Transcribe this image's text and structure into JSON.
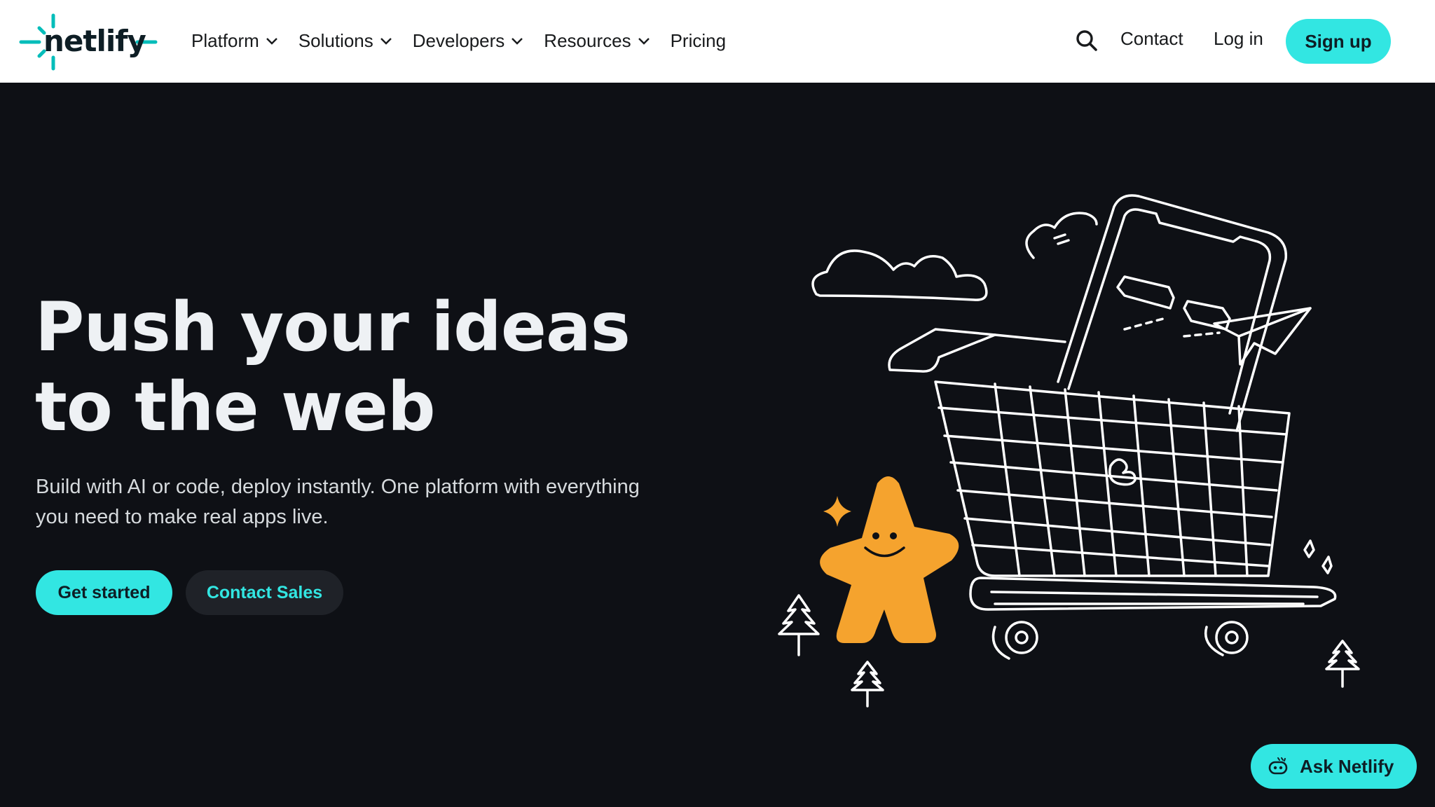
{
  "header": {
    "logo_text": "netlify",
    "nav": [
      {
        "label": "Platform",
        "has_dropdown": true
      },
      {
        "label": "Solutions",
        "has_dropdown": true
      },
      {
        "label": "Developers",
        "has_dropdown": true
      },
      {
        "label": "Resources",
        "has_dropdown": true
      },
      {
        "label": "Pricing",
        "has_dropdown": false
      }
    ],
    "search_icon": "search-icon",
    "contact_label": "Contact",
    "login_label": "Log in",
    "signup_label": "Sign up"
  },
  "hero": {
    "title_line1": "Push your ideas",
    "title_line2": "to the web",
    "subtitle_line1": "Build with AI or code, deploy instantly. One platform with everything",
    "subtitle_line2": "you need to make real apps live.",
    "primary_cta": "Get started",
    "secondary_cta": "Contact Sales"
  },
  "assistant": {
    "label": "Ask Netlify",
    "icon": "bot-icon"
  },
  "colors": {
    "accent": "#32e6e2",
    "background": "#0e1015",
    "header_bg": "#ffffff",
    "mascot": "#f5a32e",
    "logo_teal": "#05bdba"
  }
}
